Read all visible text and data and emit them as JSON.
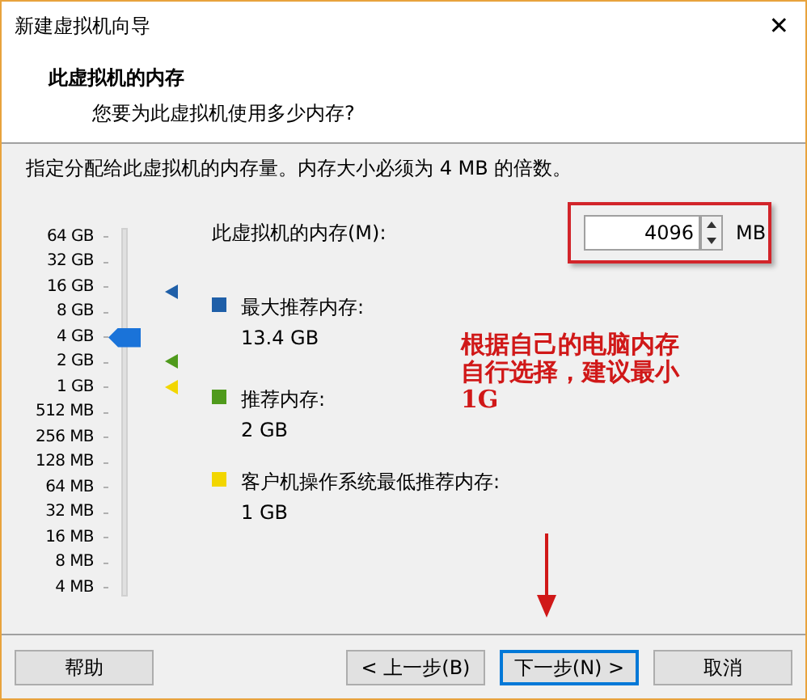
{
  "window": {
    "title": "新建虚拟机向导",
    "close": "✕"
  },
  "header": {
    "title": "此虚拟机的内存",
    "subtitle": "您要为此虚拟机使用多少内存?"
  },
  "instruction": "指定分配给此虚拟机的内存量。内存大小必须为 4 MB 的倍数。",
  "memory_slider": {
    "ticks": [
      "64 GB",
      "32 GB",
      "16 GB",
      "8 GB",
      "4 GB",
      "2 GB",
      "1 GB",
      "512 MB",
      "256 MB",
      "128 MB",
      "64 MB",
      "32 MB",
      "16 MB",
      "8 MB",
      "4 MB"
    ],
    "level": 0.714
  },
  "memory_field": {
    "label": "此虚拟机的内存(M):",
    "value": "4096",
    "unit": "MB"
  },
  "legend": [
    {
      "label": "最大推荐内存:",
      "value": "13.4 GB",
      "color": "#1f5fa8"
    },
    {
      "label": "推荐内存:",
      "value": "2 GB",
      "color": "#4f9a1c"
    },
    {
      "label": "客户机操作系统最低推荐内存:",
      "value": "1 GB",
      "color": "#f2d600"
    }
  ],
  "annotation": "根据自己的电脑内存自行选择，建议最小1G",
  "buttons": [
    {
      "label": "帮助",
      "focused": false
    },
    {
      "label": "< 上一步(B)",
      "focused": false
    },
    {
      "label": "下一步(N) >",
      "focused": true
    },
    {
      "label": "取消",
      "focused": false
    }
  ]
}
